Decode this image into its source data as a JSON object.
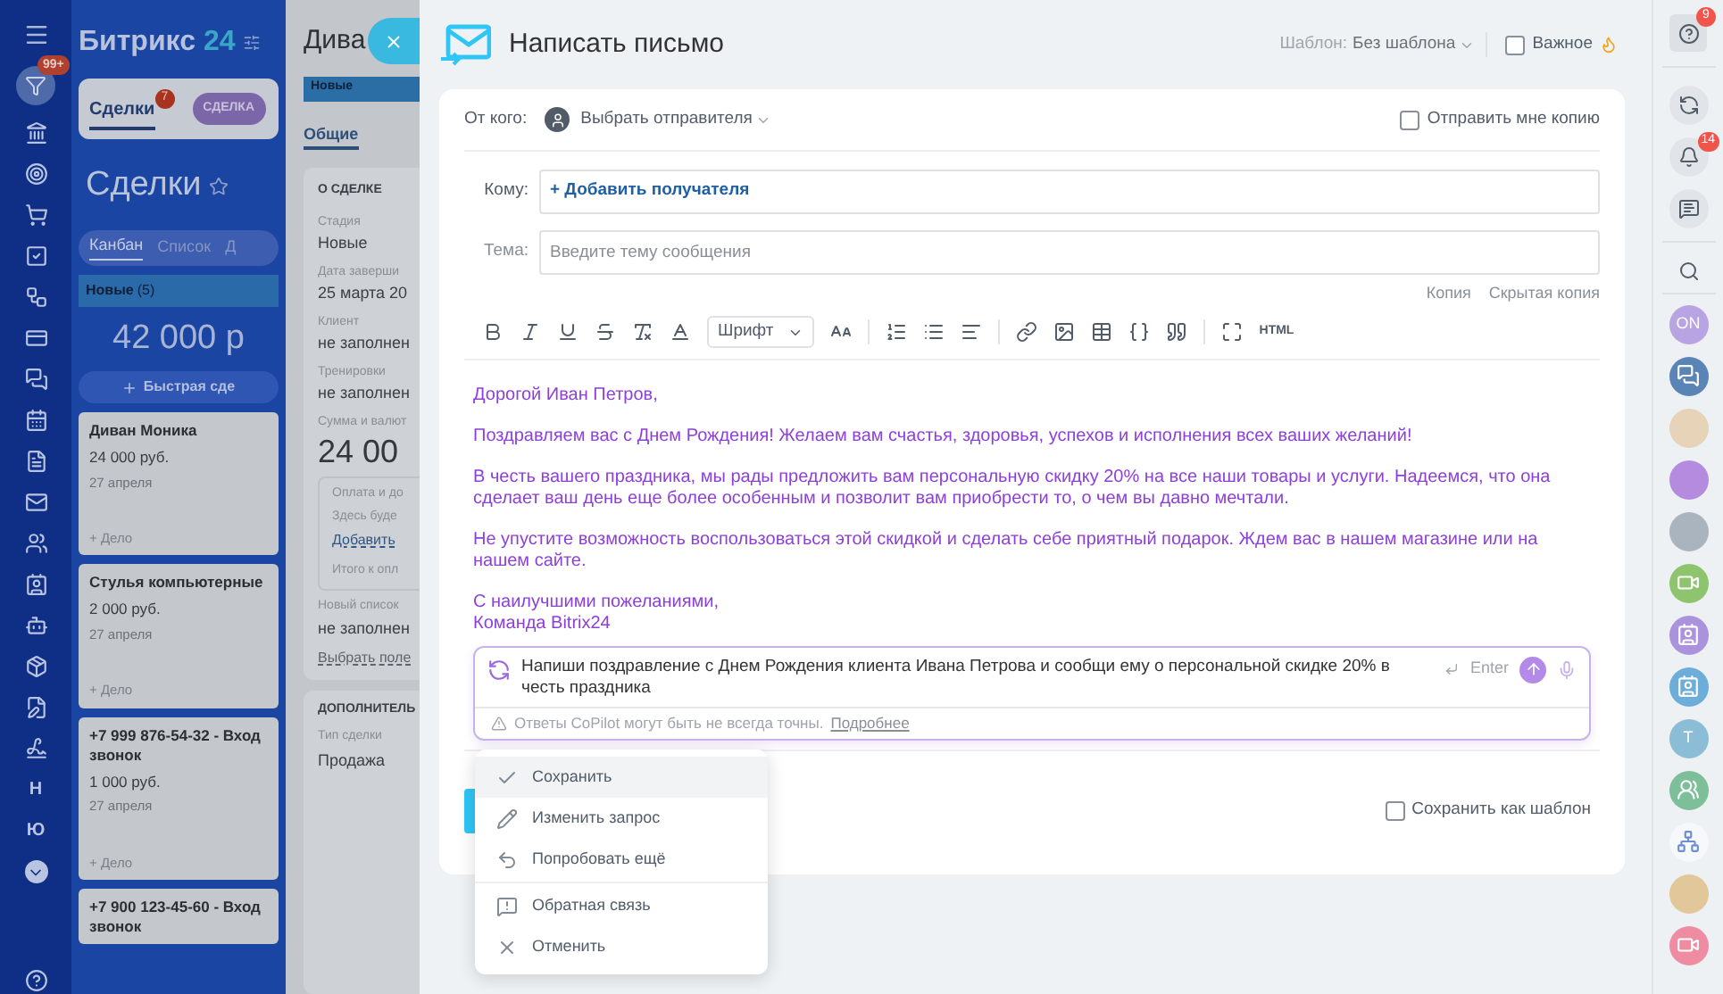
{
  "left_nav": {
    "filter_badge": "99+",
    "letter_items": [
      "Н",
      "Ю"
    ]
  },
  "crm": {
    "logo": {
      "name": "Битрикс",
      "number": "24"
    },
    "tabs": [
      {
        "label": "Сделки",
        "badge": "7",
        "selected": true
      },
      {
        "label": "СДЕЛКА",
        "selected": false
      }
    ],
    "title": "Сделки",
    "view_tabs": [
      {
        "label": "Канбан",
        "selected": true
      },
      {
        "label": "Список",
        "selected": false
      },
      {
        "label": "Д",
        "selected": false
      }
    ],
    "column": {
      "name": "Новые",
      "count": "(5)",
      "total": "42 000 р",
      "quick_add": "Быстрая сде"
    },
    "cards": [
      {
        "title": "Диван Моника",
        "price": "24 000 руб.",
        "date": "27 апреля",
        "action": "+ Дело"
      },
      {
        "title": "Стулья компьютерные",
        "price": "2 000 руб.",
        "date": "27 апреля",
        "action": "+ Дело"
      },
      {
        "title": "+7 999 876-54-32 - Вход звонок",
        "price": "1 000 руб.",
        "date": "27 апреля",
        "action": "+ Дело"
      },
      {
        "title": "+7 900 123-45-60 - Вход звонок"
      }
    ]
  },
  "deal": {
    "title": "Дива",
    "stage": "Новые",
    "tab": "Общие",
    "section": "О СДЕЛКЕ",
    "fields": [
      {
        "label": "Стадия",
        "value": "Новые"
      },
      {
        "label": "Дата заверши",
        "value": "25 марта 20"
      },
      {
        "label": "Клиент",
        "value": "не заполнен"
      },
      {
        "label": "Тренировки",
        "value": "не заполнен"
      }
    ],
    "amount_label": "Сумма и валют",
    "amount": "24 00",
    "payment": {
      "title": "Оплата и до",
      "hint": "Здесь буде",
      "add": "Добавить",
      "total": "Итого к опл"
    },
    "list_field": {
      "label": "Новый список",
      "value": "не заполнен"
    },
    "select_field": "Выбрать поле",
    "section2": "ДОПОЛНИТЕЛЬ",
    "type_field": {
      "label": "Тип сделки",
      "value": "Продажа"
    }
  },
  "mail": {
    "title": "Написать письмо",
    "template_label": "Шаблон:",
    "template": "Без шаблона",
    "important": {
      "label": "Важное",
      "checked": false
    },
    "from_label": "От кого:",
    "sender": "Выбрать отправителя",
    "send_copy": {
      "label": "Отправить мне копию",
      "checked": false
    },
    "to_label": "Кому:",
    "add_recipient": "+ Добавить получателя",
    "subject_label": "Тема:",
    "subject_placeholder": "Введите тему сообщения",
    "cc": "Копия",
    "bcc": "Скрытая копия",
    "toolbar": {
      "font": "Шрифт",
      "html": "HTML"
    },
    "body": [
      [
        "Дорогой Иван Петров,"
      ],
      [
        "Поздравляем вас с Днем Рождения! Желаем вам счастья, здоровья, успехов и исполнения всех ваших желаний!"
      ],
      [
        "В честь вашего праздника, мы рады предложить вам персональную скидку 20% на все наши товары и услуги. Надеемся, что она сделает ваш день еще более особенным и позволит вам приобрести то, о чем вы давно мечтали."
      ],
      [
        "Не упустите возможность воспользоваться этой скидкой и сделать себе приятный подарок. Ждем вас в нашем магазине или на нашем сайте."
      ],
      [
        "С наилучшими пожеланиями,",
        "Команда Bitrix24"
      ]
    ],
    "copilot": {
      "prompt": "Напиши поздравление с Днем Рождения клиента Ивана Петрова и сообщи ему о персональной скидке 20% в честь праздника",
      "enter": "Enter",
      "disclaimer": "Ответы CoPilot могут быть не всегда точны.",
      "more": "Подробнее"
    },
    "menu": [
      {
        "label": "Сохранить",
        "kind": "check",
        "selected": true
      },
      {
        "label": "Изменить запрос",
        "kind": "pencil",
        "selected": false
      },
      {
        "label": "Попробовать ещё",
        "kind": "undo",
        "selected": false
      },
      {
        "label": "Обратная связь",
        "kind": "feedback",
        "selected": false
      },
      {
        "label": "Отменить",
        "kind": "cancel",
        "selected": false
      }
    ],
    "save_template": {
      "label": "Сохранить как шаблон",
      "checked": false
    }
  },
  "right_bar": {
    "help_badge": "9",
    "bell_badge": "14",
    "items": [
      {
        "kind": "initials",
        "text": "ON",
        "color": "#b8a3e3"
      },
      {
        "kind": "chat",
        "color": "#5a84b5"
      },
      {
        "kind": "photo",
        "color": "#e6d3b8"
      },
      {
        "kind": "photo",
        "color": "#b58be0"
      },
      {
        "kind": "photo",
        "color": "#a9b4bf"
      },
      {
        "kind": "video",
        "color": "#8fc46f"
      },
      {
        "kind": "card",
        "color": "#ab92dc"
      },
      {
        "kind": "card",
        "color": "#6cadd9"
      },
      {
        "kind": "initials",
        "text": "T",
        "color": "#8bbdd6"
      },
      {
        "kind": "people",
        "color": "#7cbf99"
      },
      {
        "kind": "flow",
        "color": "#f7f8fc"
      },
      {
        "kind": "photo",
        "color": "#e2c79a"
      },
      {
        "kind": "video",
        "color": "#f08ca2"
      }
    ]
  }
}
